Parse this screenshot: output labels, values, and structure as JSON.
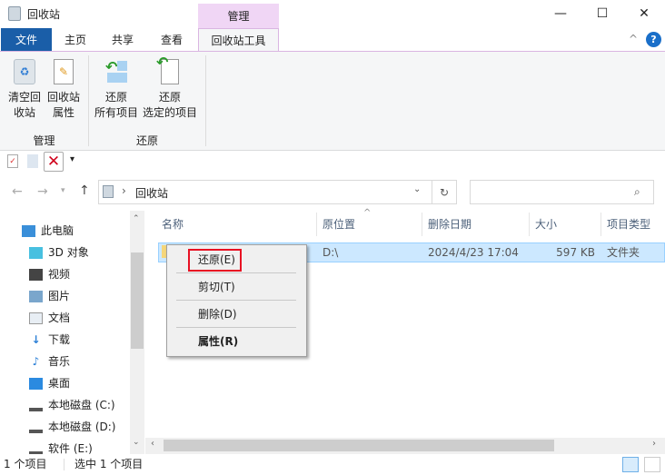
{
  "window": {
    "title": "回收站",
    "context_tab_group": "管理",
    "minimize": "—",
    "maximize": "☐",
    "close": "✕"
  },
  "tabs": [
    {
      "label": "文件"
    },
    {
      "label": "主页"
    },
    {
      "label": "共享"
    },
    {
      "label": "查看"
    },
    {
      "label": "回收站工具"
    }
  ],
  "ribbon": {
    "buttons": [
      {
        "label1": "清空回",
        "label2": "收站",
        "icon": "empty-recycle-bin-icon"
      },
      {
        "label1": "回收站",
        "label2": "属性",
        "icon": "properties-icon"
      },
      {
        "label1": "还原",
        "label2": "所有项目",
        "icon": "restore-all-icon"
      },
      {
        "label1": "还原",
        "label2": "选定的项目",
        "icon": "restore-selected-icon"
      }
    ],
    "groups": [
      {
        "label": "管理"
      },
      {
        "label": "还原"
      }
    ]
  },
  "address": {
    "path": "回收站",
    "search_placeholder": ""
  },
  "nav": [
    {
      "label": "此电脑",
      "icon": "computer-icon"
    },
    {
      "label": "3D 对象",
      "icon": "3d-objects-icon"
    },
    {
      "label": "视频",
      "icon": "video-icon"
    },
    {
      "label": "图片",
      "icon": "pictures-icon"
    },
    {
      "label": "文档",
      "icon": "documents-icon"
    },
    {
      "label": "下载",
      "icon": "download-icon"
    },
    {
      "label": "音乐",
      "icon": "music-icon"
    },
    {
      "label": "桌面",
      "icon": "desktop-icon"
    },
    {
      "label": "本地磁盘 (C:)",
      "icon": "drive-icon"
    },
    {
      "label": "本地磁盘 (D:)",
      "icon": "drive-icon"
    },
    {
      "label": "软件 (E:)",
      "icon": "drive-icon"
    }
  ],
  "columns": [
    {
      "label": "名称"
    },
    {
      "label": "原位置"
    },
    {
      "label": "删除日期"
    },
    {
      "label": "大小"
    },
    {
      "label": "项目类型"
    }
  ],
  "rows": [
    {
      "name": "",
      "location": "D:\\",
      "deleted": "2024/4/23 17:04",
      "size": "597 KB",
      "type": "文件夹"
    }
  ],
  "context_menu": [
    {
      "label": "还原(E)"
    },
    {
      "label": "剪切(T)"
    },
    {
      "label": "删除(D)"
    },
    {
      "label": "属性(R)"
    }
  ],
  "status": {
    "count": "1 个项目",
    "selected": "选中 1 个项目"
  },
  "colors": {
    "accent": "#1a5ea8",
    "highlight": "#cce8ff",
    "menu_highlight_border": "#e81123"
  }
}
